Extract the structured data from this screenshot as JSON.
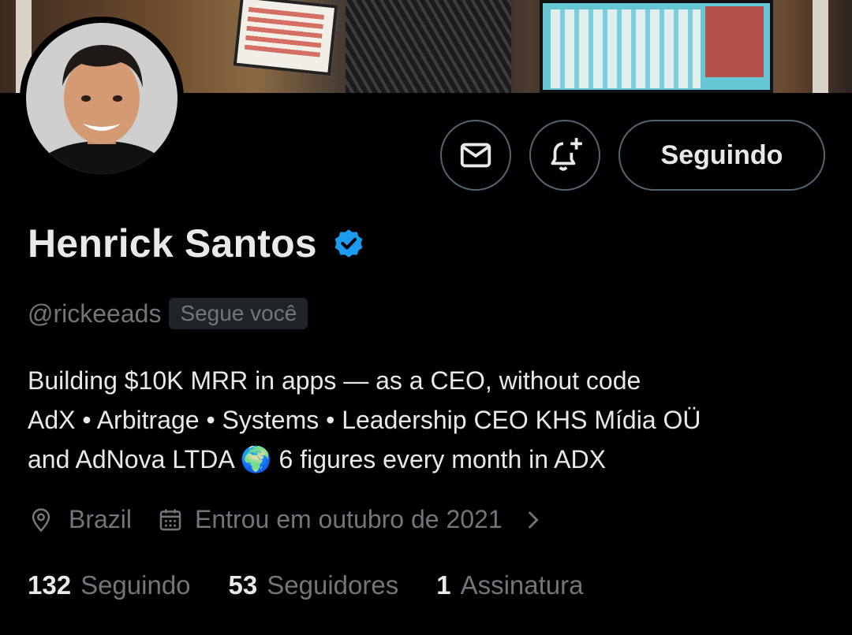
{
  "profile": {
    "name": "Henrick Santos",
    "handle": "@rickeeads",
    "follows_you": "Segue você",
    "bio_lines": [
      "Building $10K MRR in apps —  as a CEO, without code",
      "AdX • Arbitrage • Systems • Leadership CEO KHS Mídia OÜ",
      "and AdNova LTDA 🌍 6 figures every month in ADX"
    ],
    "location": "Brazil",
    "joined": "Entrou em outubro de 2021"
  },
  "actions": {
    "message_icon": "envelope-icon",
    "notify_icon": "bell-plus-icon",
    "follow_label": "Seguindo"
  },
  "stats": {
    "following_count": "132",
    "following_label": "Seguindo",
    "followers_count": "53",
    "followers_label": "Seguidores",
    "subscriptions_count": "1",
    "subscriptions_label": "Assinatura"
  },
  "colors": {
    "background": "#000000",
    "primary_text": "#e7e9ea",
    "secondary_text": "#71767b",
    "verified": "#1d9bf0",
    "button_border": "#536471"
  }
}
